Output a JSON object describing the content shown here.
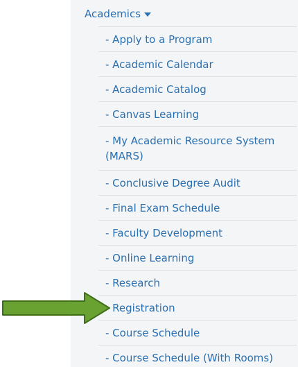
{
  "menu": {
    "header_label": "Academics",
    "header_icon": "chevron-down-icon",
    "items": [
      {
        "label": "- Apply to a Program"
      },
      {
        "label": "- Academic Calendar"
      },
      {
        "label": "- Academic Catalog"
      },
      {
        "label": "- Canvas Learning"
      },
      {
        "label": "- My Academic Resource System (MARS)"
      },
      {
        "label": "- Conclusive Degree Audit"
      },
      {
        "label": "- Final Exam Schedule"
      },
      {
        "label": "- Faculty Development"
      },
      {
        "label": "- Online Learning"
      },
      {
        "label": "- Research"
      },
      {
        "label": "- Registration"
      },
      {
        "label": "- Course Schedule"
      },
      {
        "label": "- Course Schedule (With Rooms)"
      }
    ]
  },
  "annotation": {
    "icon": "arrow-right-icon",
    "points_to": "- Registration",
    "fill_color": "#6aa232",
    "stroke_color": "#3f6e1a"
  },
  "colors": {
    "link": "#2a6fb0",
    "panel_bg": "#f4f5f7",
    "divider": "#dcdfe4"
  }
}
